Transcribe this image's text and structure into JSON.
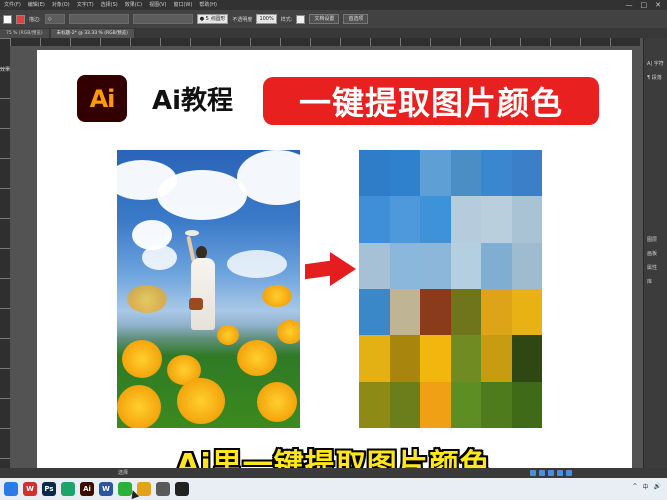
{
  "menu": {
    "items": [
      "文件(F)",
      "编辑(E)",
      "对象(O)",
      "文字(T)",
      "选择(S)",
      "效果(C)",
      "视图(V)",
      "窗口(W)",
      "帮助(H)"
    ],
    "window_controls": [
      "—",
      "□",
      "✕"
    ]
  },
  "control_bar": {
    "stroke_label": "描边:",
    "stroke_value": "◇",
    "brush_value": "● 5 点圆形",
    "opacity_label": "不透明度",
    "opacity_value": "100%",
    "style_label": "样式:",
    "doc_settings_button": "文档设置",
    "preferences_button": "首选项"
  },
  "tabs": [
    {
      "label": "75 % (RGB/预览)",
      "active": false
    },
    {
      "label": "未标题-2* @ 33.33 % (RGB/预览)",
      "active": true
    }
  ],
  "left_ruler_label": "效果",
  "right_panel": {
    "items": [
      "A| 字符",
      "¶ 段落",
      "图层",
      "画板",
      "属性",
      "库"
    ]
  },
  "artboard": {
    "logo_text": "Ai",
    "headline": "Ai教程",
    "banner": "一键提取图片颜色"
  },
  "mosaic": {
    "colors": [
      "#2f7cc8",
      "#2f81cd",
      "#5e9fd6",
      "#4b8ec6",
      "#3a86cf",
      "#3b7fc8",
      "#3f8fd8",
      "#4e98dc",
      "#3e93d8",
      "#b6ccdc",
      "#b9cfdd",
      "#a9c3d4",
      "#a6c0d6",
      "#8cb7dc",
      "#8db6db",
      "#b3cfe0",
      "#7faed2",
      "#9fbbd0",
      "#3b88c9",
      "#bfb493",
      "#8a3b1c",
      "#6f751a",
      "#dda41a",
      "#e9b214",
      "#e3b114",
      "#a8860e",
      "#f2b70e",
      "#6f8b22",
      "#c89c10",
      "#2e4713",
      "#8e8a16",
      "#6a7e1c",
      "#f0a014",
      "#5c8e24",
      "#4e7c1c",
      "#3f6a17"
    ]
  },
  "caption": "Ai里一键提取图片颜色",
  "status_bar": {
    "text": "选择"
  },
  "taskbar": {
    "icons": [
      "windows-icon",
      "wps-icon",
      "photoshop-icon",
      "edge-icon",
      "illustrator-icon",
      "word-icon",
      "wechat-icon",
      "folder-icon",
      "game-icon",
      "capture-icon"
    ],
    "labels": [
      "",
      "W",
      "Ps",
      "",
      "Ai",
      "W",
      "",
      "",
      "",
      ""
    ],
    "colors": [
      "#2c7be5",
      "#d1312c",
      "#0b2a4a",
      "#1ea36a",
      "#3a0f00",
      "#2b579a",
      "#2bb03b",
      "#e3a21a",
      "#5a5a5a",
      "#222222"
    ],
    "tray": [
      "^",
      "中",
      "🔊"
    ]
  }
}
